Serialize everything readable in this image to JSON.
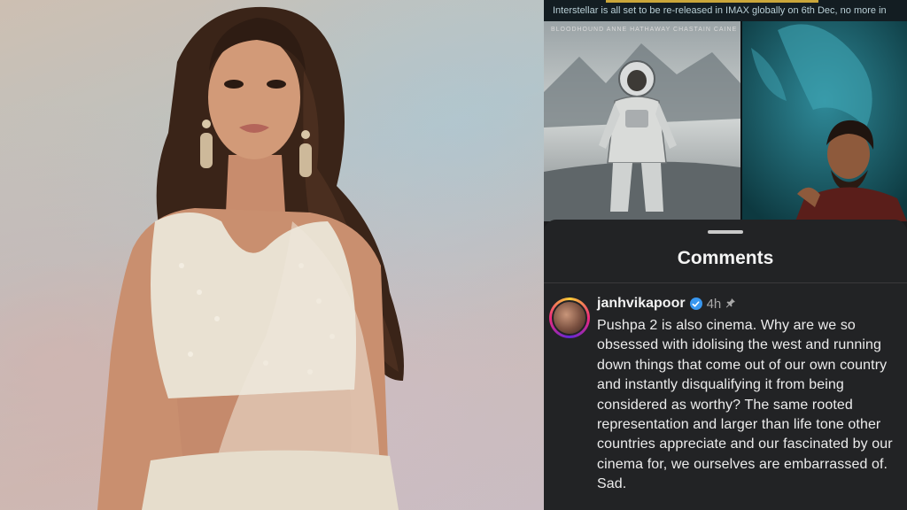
{
  "caption": "Interstellar is all set to be re-released in IMAX globally on 6th Dec, no more in",
  "poster_credits": "BLOODHOUND        ANNE HATHAWAY        CHASTAIN        CAINE",
  "comments_sheet": {
    "title": "Comments",
    "comment": {
      "username": "janhvikapoor",
      "time": "4h",
      "text": "Pushpa 2 is also cinema. Why are we so obsessed with idolising the west and running down things that come out of our own country and instantly disqualifying it from being considered as worthy? The same rooted representation and larger than life tone other countries appreciate and our fascinated by our cinema for, we ourselves are embarrassed of. Sad."
    }
  },
  "colors": {
    "sheet_bg": "#222325",
    "verified_blue": "#3897f0",
    "caption_accent": "#caa63a"
  },
  "icons": {
    "verified": "verified-badge-icon",
    "pin": "pin-icon"
  }
}
